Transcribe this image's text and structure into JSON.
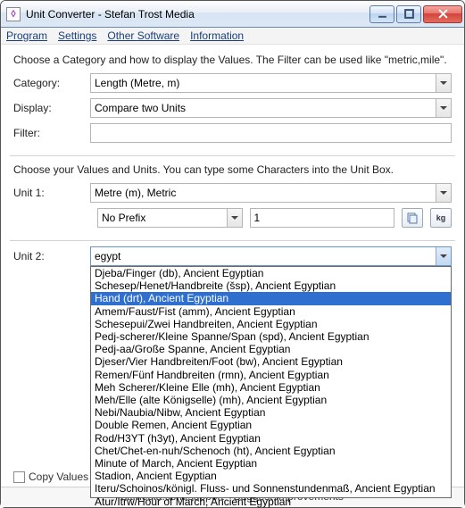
{
  "window": {
    "title": "Unit Converter - Stefan Trost Media"
  },
  "menu": {
    "program": "Program",
    "settings": "Settings",
    "other": "Other Software",
    "info": "Information"
  },
  "section1": {
    "desc": "Choose a Category and how to display the Values. The Filter can be used like \"metric,mile\".",
    "category_label": "Category:",
    "category_value": "Length (Metre, m)",
    "display_label": "Display:",
    "display_value": "Compare two Units",
    "filter_label": "Filter:",
    "filter_value": ""
  },
  "section2": {
    "desc": "Choose your Values and Units. You can type some Characters into the Unit Box.",
    "unit1_label": "Unit 1:",
    "unit1_value": "Metre (m), Metric",
    "prefix_value": "No Prefix",
    "number_value": "1",
    "unit2_label": "Unit 2:",
    "unit2_value": "egypt",
    "options": [
      "Djeba/Finger (db), Ancient Egyptian",
      "Schesep/Henet/Handbreite (šsp), Ancient Egyptian",
      "Hand (drt), Ancient Egyptian",
      "Amem/Faust/Fist (amm), Ancient Egyptian",
      "Schesepui/Zwei Handbreiten, Ancient Egyptian",
      "Pedj-scherer/Kleine Spanne/Span (spd), Ancient Egyptian",
      "Pedj-aa/Große Spanne, Ancient Egyptian",
      "Djeser/Vier Handbreiten/Foot (bw), Ancient Egyptian",
      "Remen/Fünf Handbreiten (rmn), Ancient Egyptian",
      "Meh Scherer/Kleine Elle (mh), Ancient Egyptian",
      "Meh/Elle (alte Königselle) (mh), Ancient Egyptian",
      "Nebi/Naubia/Nibw, Ancient Egyptian",
      "Double Remen, Ancient Egyptian",
      "Rod/H3YT (h3yt), Ancient Egyptian",
      "Chet/Chet-en-nuh/Schenoch (ht), Ancient Egyptian",
      "Minute of March, Ancient Egyptian",
      "Stadion, Ancient Egyptian",
      "Iteru/Schoinos/königl. Fluss- und Sonnenstundenmaß, Ancient Egyptian",
      "Atur/Itrw/Hour of March, Ancient Egyptian"
    ],
    "selected_index": 2
  },
  "bottom": {
    "copy": "Copy Values"
  },
  "status": "sttmedia.com/support - Suggest Improvements",
  "icons": {
    "copy": "copy-icon",
    "kg": "kg"
  }
}
